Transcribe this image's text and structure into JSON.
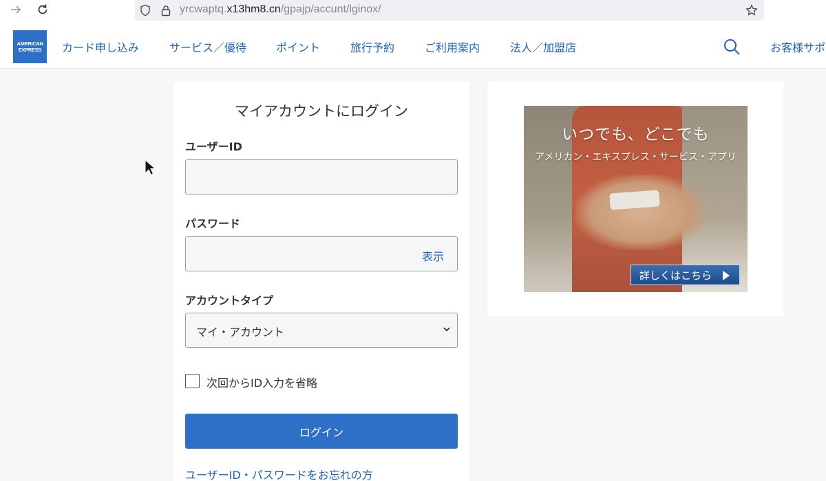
{
  "browser": {
    "url_prefix": "yrcwaptq.",
    "url_host": "x13hm8.cn",
    "url_path": "/gpajp/accunt/lginox/"
  },
  "header": {
    "logo_line1": "AMERICAN",
    "logo_line2": "EXPRESS",
    "nav": [
      {
        "label": "カード申し込み"
      },
      {
        "label": "サービス／優待"
      },
      {
        "label": "ポイント"
      },
      {
        "label": "旅行予約"
      },
      {
        "label": "ご利用案内"
      },
      {
        "label": "法人／加盟店"
      },
      {
        "label": "お客様サポ"
      }
    ]
  },
  "login": {
    "title": "マイアカウントにログイン",
    "user_id_label": "ユーザーID",
    "user_id_value": "",
    "password_label": "パスワード",
    "password_value": "",
    "show_label": "表示",
    "account_type_label": "アカウントタイプ",
    "account_type_value": "マイ・アカウント",
    "remember_label": "次回からID入力を省略",
    "remember_checked": false,
    "submit_label": "ログイン",
    "forgot_label": "ユーザーID・パスワードをお忘れの方"
  },
  "promo": {
    "headline": "いつでも、どこでも",
    "subline": "アメリカン・エキスプレス・サービス・アプリ",
    "cta": "詳しくはこちら"
  },
  "colors": {
    "brand_blue": "#2e6fc7",
    "link_blue": "#1f62b8",
    "page_bg": "#f7f7f7"
  }
}
